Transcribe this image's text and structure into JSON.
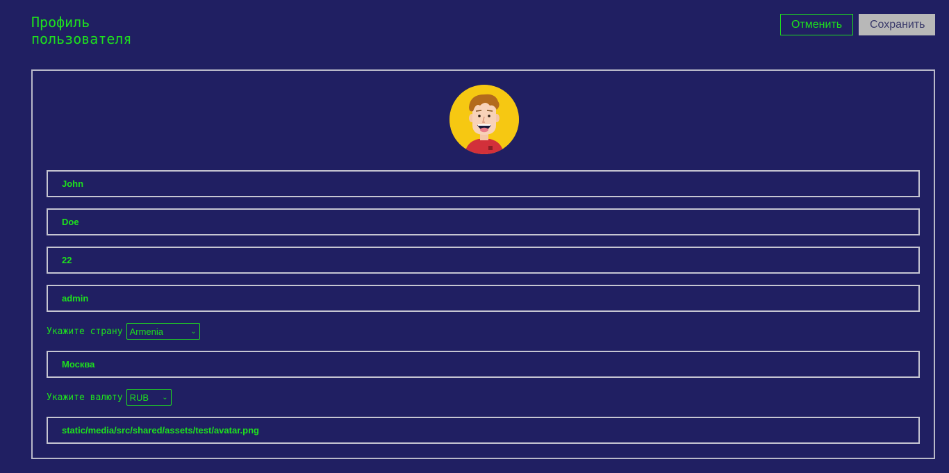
{
  "header": {
    "title": "Профиль\nпользователя",
    "cancel_label": "Отменить",
    "save_label": "Сохранить"
  },
  "profile": {
    "first_name": "John",
    "last_name": "Doe",
    "age": "22",
    "username": "admin",
    "country_label": "Укажите страну",
    "country_value": "Armenia",
    "city": "Москва",
    "currency_label": "Укажите валюту",
    "currency_value": "RUB",
    "avatar_url": "static/media/src/shared/assets/test/avatar.png"
  },
  "icons": {
    "avatar": "cartoon-user-avatar",
    "select_chevron": "chevron-down-icon"
  },
  "colors": {
    "background": "#201f62",
    "accent": "#1ee01e",
    "border": "#c6c6d2",
    "save_button": "#b8b8b8"
  }
}
